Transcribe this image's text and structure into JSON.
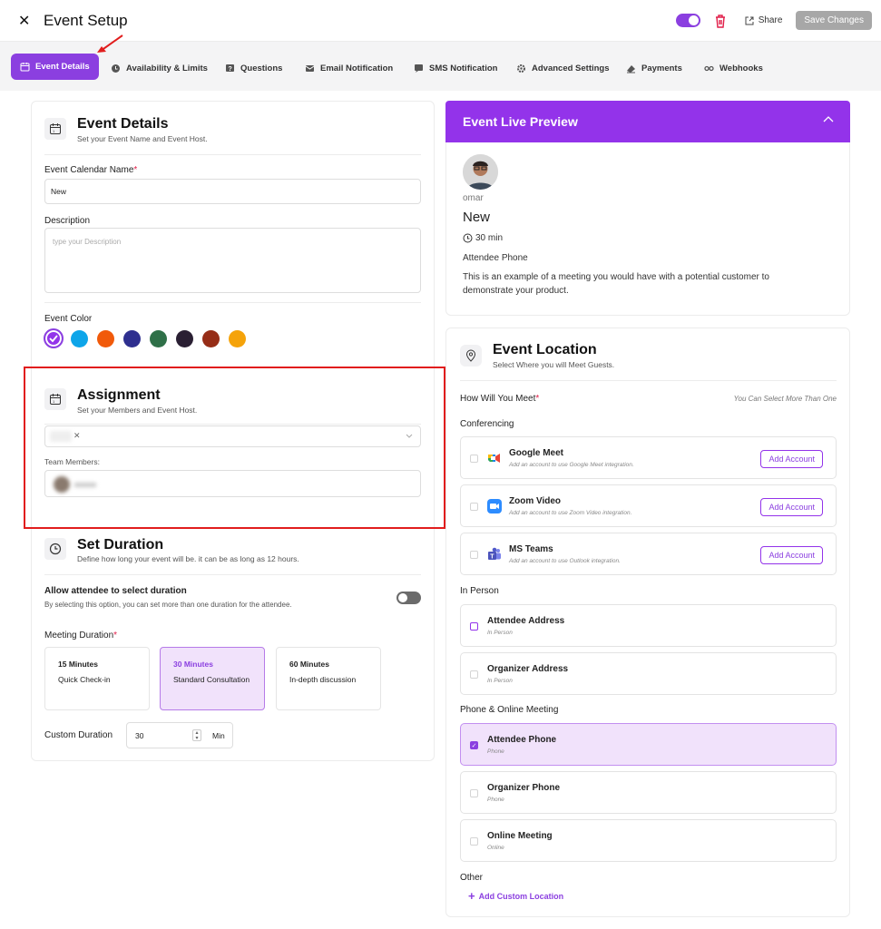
{
  "app": {
    "title": "Event Setup"
  },
  "toolbar": {
    "share_label": "Share",
    "save_label": "Save Changes"
  },
  "tabs": [
    {
      "label": "Event Details",
      "active": true
    },
    {
      "label": "Availability & Limits"
    },
    {
      "label": "Questions"
    },
    {
      "label": "Email Notification"
    },
    {
      "label": "SMS Notification"
    },
    {
      "label": "Advanced Settings"
    },
    {
      "label": "Payments"
    },
    {
      "label": "Webhooks"
    }
  ],
  "event_details": {
    "title": "Event Details",
    "subtitle": "Set your Event Name and Event Host.",
    "name_label": "Event Calendar Name",
    "name_value": "New",
    "description_label": "Description",
    "description_placeholder": "type your Description",
    "color_label": "Event Color",
    "colors": [
      "#9333ea",
      "#0ea5e9",
      "#f15a0a",
      "#2e2f8f",
      "#2f7048",
      "#2a1f33",
      "#962d17",
      "#f5a30a"
    ]
  },
  "assignment": {
    "title": "Assignment",
    "subtitle": "Set your Members and Event Host.",
    "team_members_label": "Team Members:"
  },
  "duration": {
    "title": "Set Duration",
    "subtitle": "Define how long your event will be. it can be as long as 12 hours.",
    "allow_label": "Allow attendee to select duration",
    "allow_sub": "By selecting this option, you can set more than one duration for the attendee.",
    "meeting_label": "Meeting Duration",
    "options": [
      {
        "title": "15 Minutes",
        "desc": "Quick Check-in"
      },
      {
        "title": "30 Minutes",
        "desc": "Standard Consultation",
        "selected": true
      },
      {
        "title": "60 Minutes",
        "desc": "In-depth discussion"
      }
    ],
    "custom_label": "Custom Duration",
    "custom_value": "30",
    "custom_unit": "Min"
  },
  "preview": {
    "title": "Event Live Preview",
    "host": "omar",
    "event_name": "New",
    "duration": "30 min",
    "location": "Attendee Phone",
    "description": "This is an example of a meeting you would have with a potential customer to demonstrate your product."
  },
  "location": {
    "title": "Event Location",
    "subtitle": "Select Where you will Meet Guests.",
    "how_label": "How Will You Meet",
    "hint": "You Can Select More Than One",
    "groups": {
      "conferencing": "Conferencing",
      "in_person": "In Person",
      "phone": "Phone & Online Meeting",
      "other": "Other"
    },
    "conferencing": [
      {
        "title": "Google Meet",
        "sub": "Add an account to use Google Meet integration.",
        "button": "Add Account"
      },
      {
        "title": "Zoom Video",
        "sub": "Add an account to use Zoom Video integration.",
        "button": "Add Account"
      },
      {
        "title": "MS Teams",
        "sub": "Add an account to use Outlook integration.",
        "button": "Add Account"
      }
    ],
    "in_person": [
      {
        "title": "Attendee Address",
        "sub": "In Person"
      },
      {
        "title": "Organizer Address",
        "sub": "In Person"
      }
    ],
    "phone": [
      {
        "title": "Attendee Phone",
        "sub": "Phone",
        "checked": true
      },
      {
        "title": "Organizer Phone",
        "sub": "Phone"
      },
      {
        "title": "Online Meeting",
        "sub": "Online"
      }
    ],
    "add_custom": "Add Custom Location"
  },
  "accent_color": "#9333ea"
}
